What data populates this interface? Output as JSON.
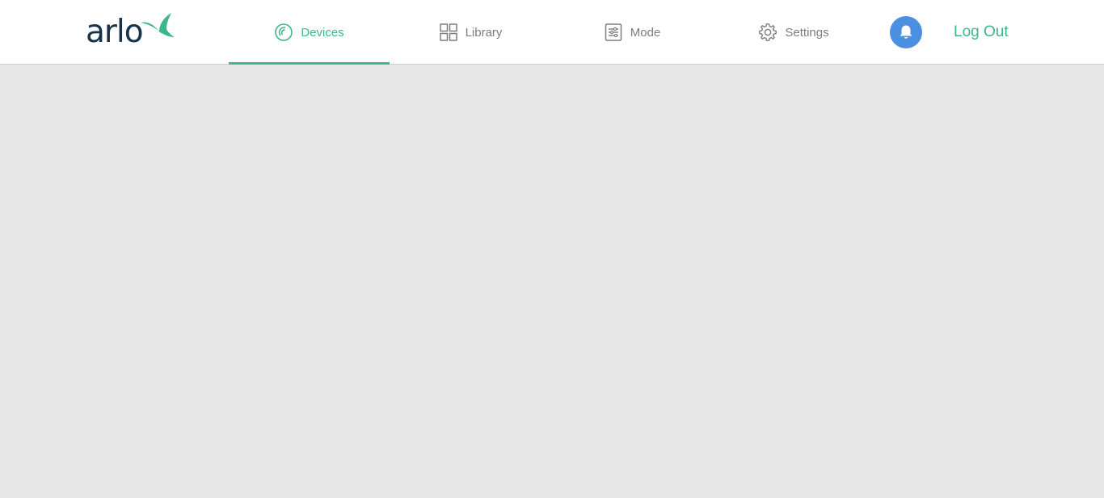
{
  "brand": {
    "logo_text": "arlo",
    "logo_icon": "bird-icon",
    "text_color": "#18324a",
    "accent_color": "#3fb58b"
  },
  "nav": {
    "tabs": [
      {
        "label": "Devices",
        "icon": "devices-icon",
        "active": true
      },
      {
        "label": "Library",
        "icon": "grid-icon",
        "active": false
      },
      {
        "label": "Mode",
        "icon": "mode-icon",
        "active": false
      },
      {
        "label": "Settings",
        "icon": "gear-icon",
        "active": false
      }
    ],
    "active_color": "#3fb58b",
    "inactive_color": "#7d7d7d"
  },
  "notifications": {
    "icon": "bell-icon",
    "color": "#4a8fe0"
  },
  "logout": {
    "label": "Log Out"
  },
  "page": {
    "background": "#e7e7e7",
    "header_background": "#ffffff"
  }
}
